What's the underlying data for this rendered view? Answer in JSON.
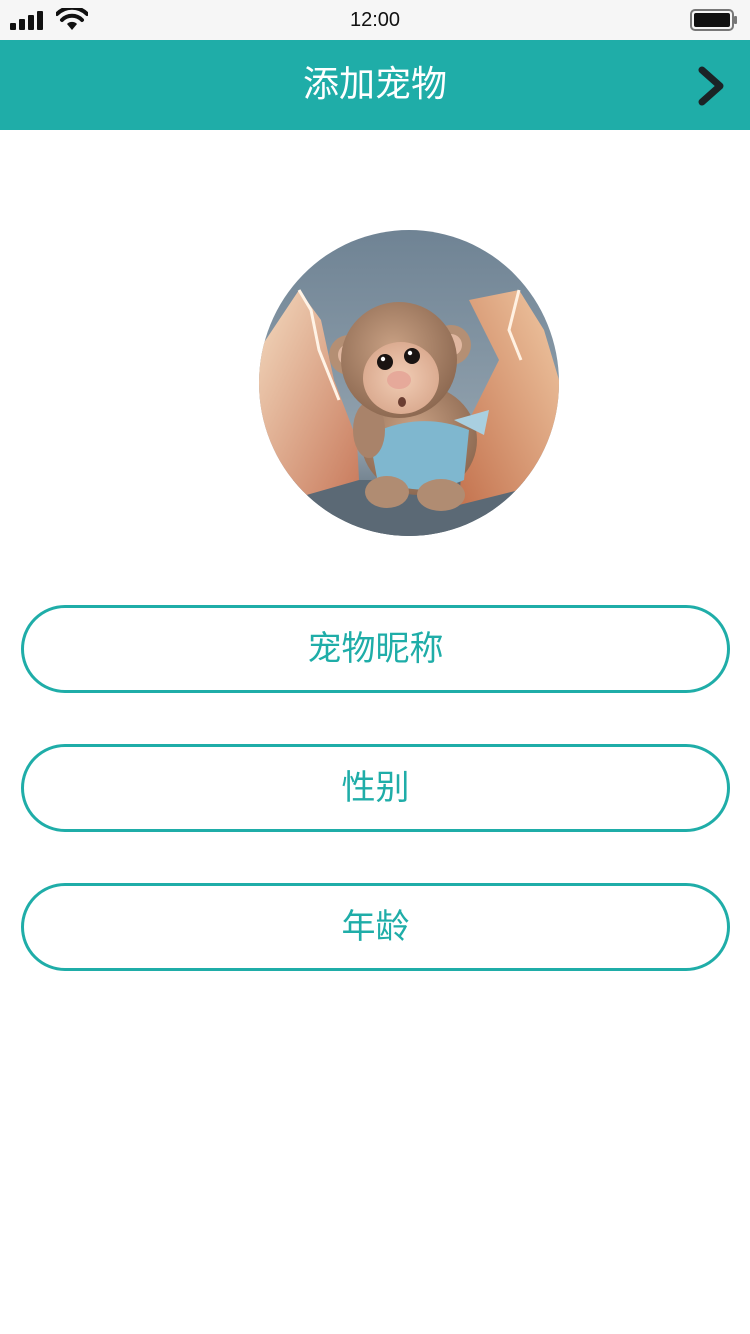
{
  "status_bar": {
    "time": "12:00",
    "icons": [
      "signal-icon",
      "wifi-icon",
      "battery-icon"
    ]
  },
  "header": {
    "title": "添加宠物",
    "forward_icon": "chevron-right-icon"
  },
  "avatar": {
    "description_icon": "pet-avatar"
  },
  "form": {
    "fields": [
      {
        "label": "宠物昵称"
      },
      {
        "label": "性别"
      },
      {
        "label": "年龄"
      }
    ]
  },
  "colors": {
    "accent": "#1fada8",
    "header_text": "#ffffff",
    "background": "#ffffff",
    "status_bar": "#f6f6f6"
  }
}
